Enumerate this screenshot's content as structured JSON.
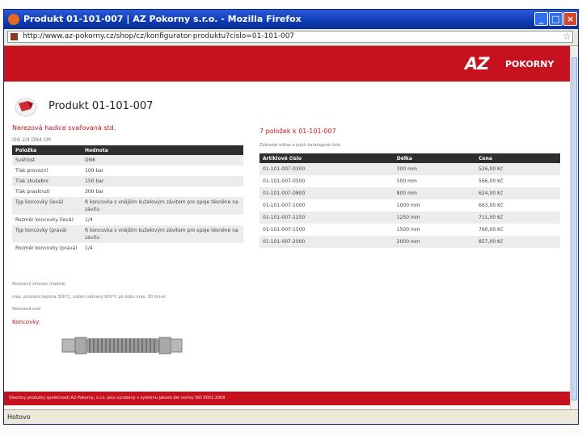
{
  "window": {
    "title": "Produkt 01-101-007 | AZ Pokorny s.r.o. - Mozilla Firefox",
    "url": "http://www.az-pokorny.cz/shop/cz/konfigurator-produktu?cislo=01-101-007"
  },
  "header": {
    "logo_mark": "AZ",
    "logo_text": "POKORNY",
    "brand_color": "#c8111f"
  },
  "product": {
    "title": "Produkt 01-101-007",
    "subtitle": "Nerezová hadice svařovaná std.",
    "spec_code": "ISO 2/4 DN4 CM",
    "table_headers": [
      "Položka",
      "Hodnota"
    ],
    "specs": [
      {
        "key": "Světlost",
        "value": "DN6"
      },
      {
        "key": "Tlak provozní",
        "value": "100 bar"
      },
      {
        "key": "Tlak zkušební",
        "value": "150 bar"
      },
      {
        "key": "Tlak prasknutí",
        "value": "300 bar"
      },
      {
        "key": "Typ koncovky (levá)",
        "value": "R koncovka s vnějším kuželovým závitem pro spoje těsněné na závitu"
      },
      {
        "key": "Rozměr koncovky (levá)",
        "value": "1/4"
      },
      {
        "key": "Typ koncovky (pravá)",
        "value": "R koncovka s vnějším kuželovým závitem pro spoje těsněné na závitu"
      },
      {
        "key": "Rozměr koncovky (pravá)",
        "value": "1/4"
      }
    ],
    "note_1": "Nerezový vlnovec (hadice)",
    "note_2": "max. provozní teplota 300°C, zúžení zábrany 600°C po dobu max. 30 minut",
    "note_3": "Nerezová ocel",
    "koncovky_label": "Koncovky:"
  },
  "variants": {
    "title": "7 položek k 01-101-007",
    "subtitle": "Zobrazte odkaz a jejich katalogové číslo",
    "table_headers": [
      "Artiklové číslo",
      "Délka",
      "Cena"
    ],
    "rows": [
      {
        "code": "01-101-007-0300",
        "length": "300 mm",
        "price": "526,00 Kč"
      },
      {
        "code": "01-101-007-0500",
        "length": "500 mm",
        "price": "566,00 Kč"
      },
      {
        "code": "01-101-007-0800",
        "length": "800 mm",
        "price": "624,00 Kč"
      },
      {
        "code": "01-101-007-1000",
        "length": "1000 mm",
        "price": "663,00 Kč"
      },
      {
        "code": "01-101-007-1250",
        "length": "1250 mm",
        "price": "711,00 Kč"
      },
      {
        "code": "01-101-007-1500",
        "length": "1500 mm",
        "price": "760,00 Kč"
      },
      {
        "code": "01-101-007-2000",
        "length": "2000 mm",
        "price": "857,00 Kč"
      }
    ]
  },
  "footer": {
    "text": "Všechny produkty společnosti AZ-Pokorny, s.r.o. jsou vyrobeny v systému jakosti dle normy ISO 9001:2008"
  },
  "status": {
    "text": "Hotovo"
  }
}
